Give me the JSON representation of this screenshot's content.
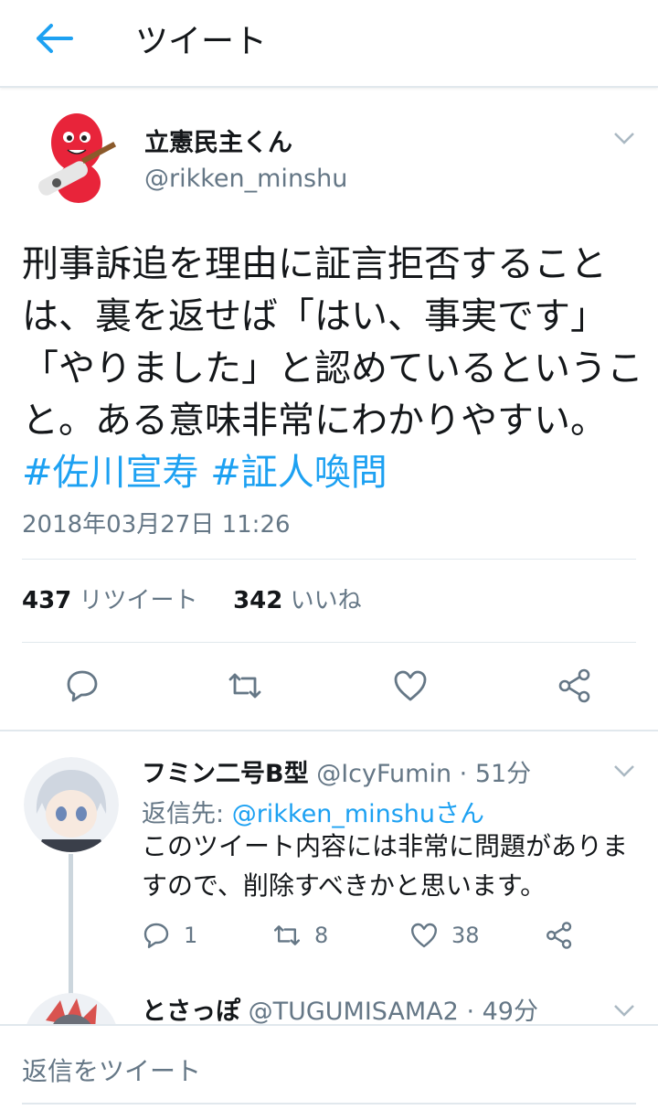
{
  "header": {
    "title": "ツイート",
    "back_icon": "arrow-left-icon",
    "accent": "#1da1f2"
  },
  "tweet": {
    "author_name": "立憲民主くん",
    "author_handle": "@rikken_minshu",
    "text": "刑事訴追を理由に証言拒否することは、裏を返せば「はい、事実です」「やりました」と認めているということ。ある意味非常にわかりやすい。",
    "hashtags": [
      "#佐川宣寿",
      "#証人喚問"
    ],
    "timestamp": "2018年03月27日 11:26",
    "retweet_count": "437",
    "retweet_label": "リツイート",
    "like_count": "342",
    "like_label": "いいね",
    "actions": [
      "reply-icon",
      "retweet-icon",
      "heart-icon",
      "share-icon"
    ]
  },
  "replies": [
    {
      "name": "フミン二号B型",
      "handle": "@IcyFumin",
      "time": "51分",
      "reply_to_prefix": "返信先: ",
      "reply_to_mention": "@rikken_minshu",
      "reply_to_suffix": "さん",
      "text": "このツイート内容には非常に問題がありますので、削除すべきかと思います。",
      "reply_count": "1",
      "retweet_count": "8",
      "like_count": "38"
    },
    {
      "name": "とさっぽ",
      "handle": "@TUGUMISAMA2",
      "time": "49分"
    }
  ],
  "composer": {
    "placeholder": "返信をツイート"
  }
}
